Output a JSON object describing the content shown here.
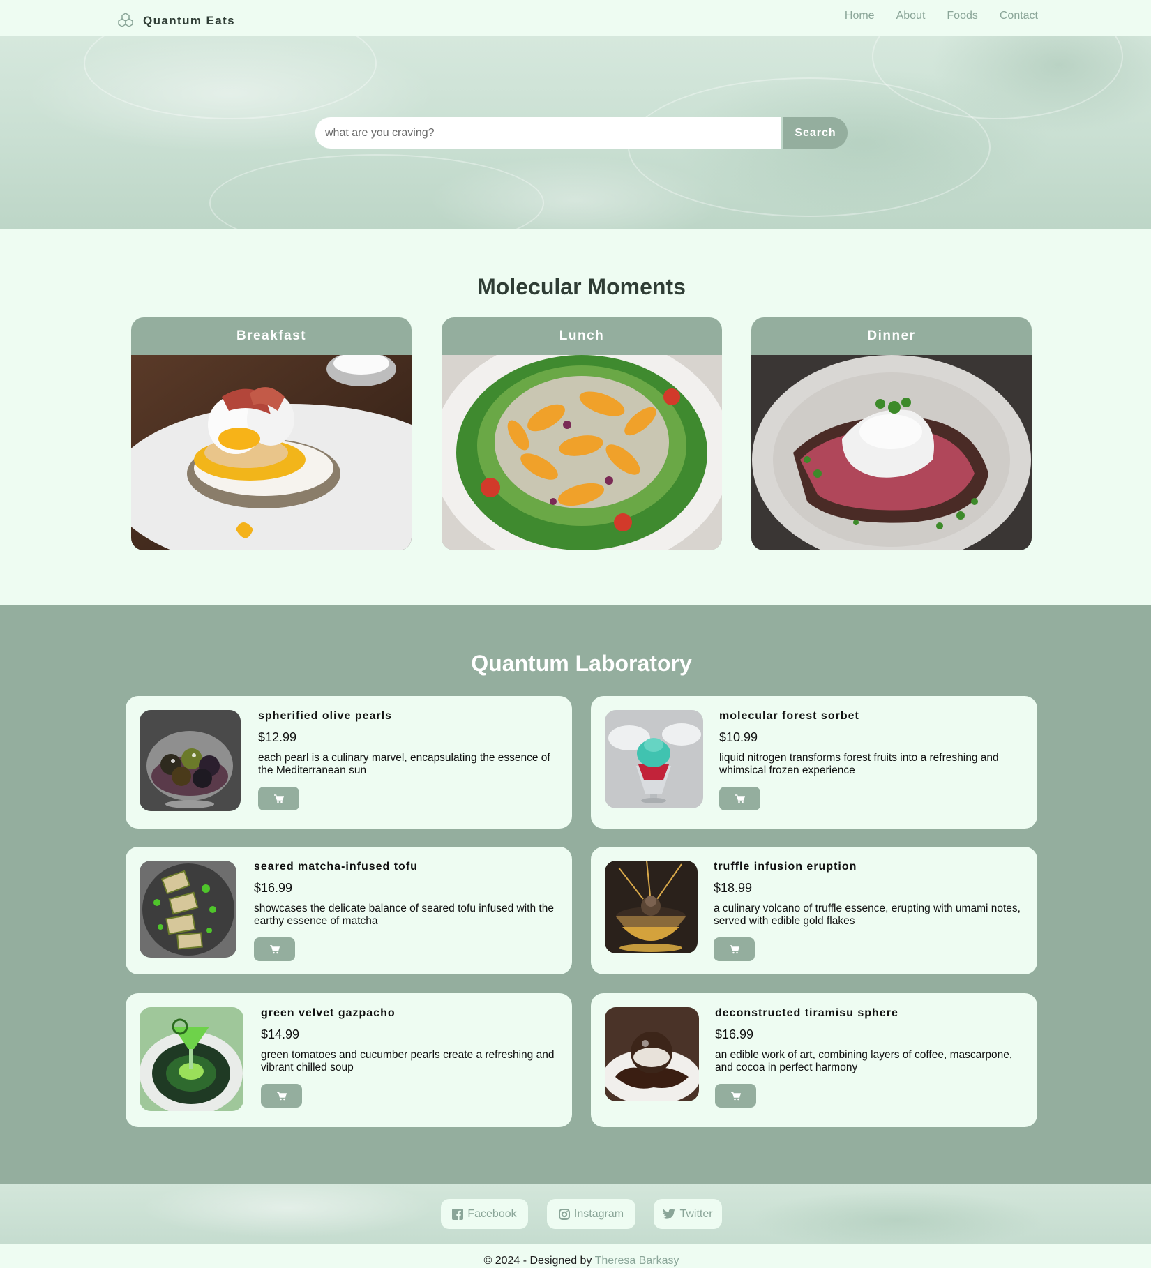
{
  "nav": {
    "brand": "Quantum Eats",
    "links": [
      "Home",
      "About",
      "Foods",
      "Contact"
    ]
  },
  "hero": {
    "search_placeholder": "what are you craving?",
    "search_button": "Search"
  },
  "moments": {
    "title": "Molecular Moments",
    "cards": [
      "Breakfast",
      "Lunch",
      "Dinner"
    ]
  },
  "lab": {
    "title": "Quantum Laboratory",
    "items": [
      {
        "name": "spherified olive pearls",
        "price": "$12.99",
        "desc": "each pearl is a culinary marvel, encapsulating the essence of the Mediterranean sun"
      },
      {
        "name": "molecular forest sorbet",
        "price": "$10.99",
        "desc": "liquid nitrogen transforms forest fruits into a refreshing and whimsical frozen experience"
      },
      {
        "name": "seared matcha-infused tofu",
        "price": "$16.99",
        "desc": "showcases the delicate balance of seared tofu infused with the earthy essence of matcha"
      },
      {
        "name": "truffle infusion eruption",
        "price": "$18.99",
        "desc": "a culinary volcano of truffle essence, erupting with umami notes, served with edible gold flakes"
      },
      {
        "name": "green velvet gazpacho",
        "price": "$14.99",
        "desc": "green tomatoes and cucumber pearls create a refreshing and vibrant chilled soup"
      },
      {
        "name": "deconstructed tiramisu sphere",
        "price": "$16.99",
        "desc": "an edible work of art, combining layers of coffee, mascarpone, and cocoa in perfect harmony"
      }
    ]
  },
  "footer": {
    "social": [
      "Facebook",
      "Instagram",
      "Twitter"
    ],
    "copyright_prefix": "© 2024 - Designed by ",
    "designer": "Theresa Barkasy"
  },
  "colors": {
    "accent": "#94ae9e",
    "background": "#eefcf2",
    "link": "#8aa598"
  }
}
